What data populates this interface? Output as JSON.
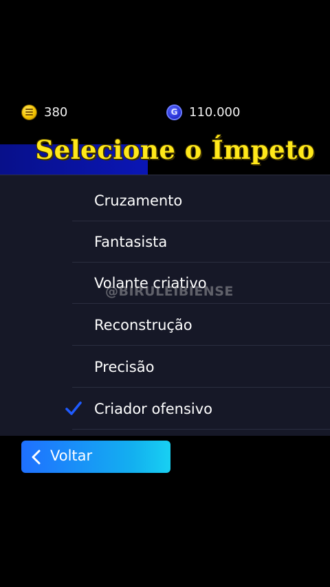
{
  "currency": {
    "coins": {
      "icon": "gold-coin-icon",
      "value": "380"
    },
    "gp": {
      "icon": "gp-coin-icon",
      "symbol": "G",
      "value": "110.000"
    }
  },
  "title": "Selecione o Ímpeto",
  "options": [
    {
      "label": "Cruzamento",
      "selected": false
    },
    {
      "label": "Fantasista",
      "selected": false
    },
    {
      "label": "Volante criativo",
      "selected": false
    },
    {
      "label": "Reconstrução",
      "selected": false
    },
    {
      "label": "Precisão",
      "selected": false
    },
    {
      "label": "Criador ofensivo",
      "selected": true
    }
  ],
  "watermark": "@BIRULEIBIENSE",
  "back_button": {
    "label": "Voltar",
    "icon": "chevron-left-icon"
  },
  "colors": {
    "title": "#ffe81a",
    "accent_blue": "#0a16b5",
    "check": "#1f5bff",
    "button_start": "#1f70ff",
    "button_end": "#18d0f2",
    "panel": "#161827"
  }
}
